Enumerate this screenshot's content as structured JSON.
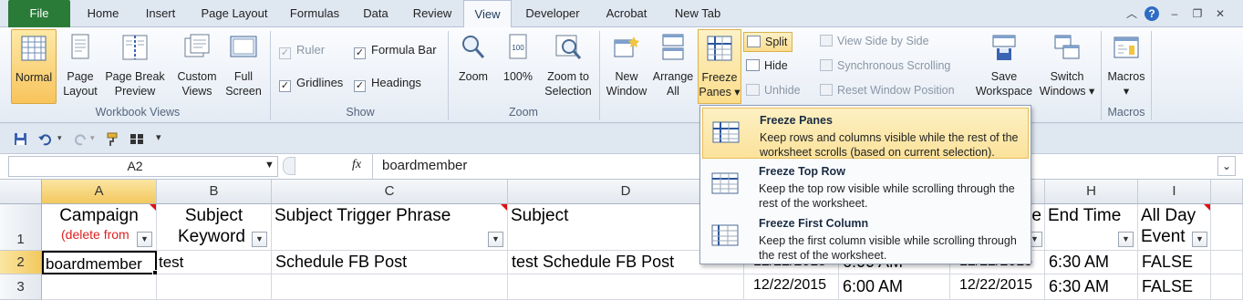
{
  "tabs": [
    "File",
    "Home",
    "Insert",
    "Page Layout",
    "Formulas",
    "Data",
    "Review",
    "View",
    "Developer",
    "Acrobat",
    "New Tab"
  ],
  "ribbon": {
    "workbook_views": {
      "label": "Workbook Views",
      "normal": "Normal",
      "page_layout": [
        "Page",
        "Layout"
      ],
      "page_break_preview": [
        "Page Break",
        "Preview"
      ],
      "custom_views": [
        "Custom",
        "Views"
      ],
      "full_screen": [
        "Full",
        "Screen"
      ]
    },
    "show": {
      "label": "Show",
      "ruler": "Ruler",
      "formula_bar": "Formula Bar",
      "gridlines": "Gridlines",
      "headings": "Headings"
    },
    "zoom": {
      "label": "Zoom",
      "zoom": "Zoom",
      "zoom_100": "100%",
      "zoom_to_selection": [
        "Zoom to",
        "Selection"
      ]
    },
    "window": {
      "new_window": [
        "New",
        "Window"
      ],
      "arrange_all": [
        "Arrange",
        "All"
      ],
      "freeze_panes": [
        "Freeze",
        "Panes ▾"
      ],
      "split": "Split",
      "hide": "Hide",
      "unhide": "Unhide",
      "view_side_by_side": "View Side by Side",
      "synchronous_scrolling": "Synchronous Scrolling",
      "reset_window_position": "Reset Window Position",
      "save_workspace": [
        "Save",
        "Workspace"
      ],
      "switch_windows": [
        "Switch",
        "Windows ▾"
      ]
    },
    "macros": {
      "label": "Macros",
      "macros": "Macros"
    }
  },
  "formula_bar": {
    "name_box": "A2",
    "fx": "fx",
    "content": "boardmember"
  },
  "columns": [
    "A",
    "B",
    "C",
    "D",
    "H",
    "I"
  ],
  "rows": [
    "1",
    "2",
    "3"
  ],
  "cells": {
    "a1_line1": "Campaign",
    "a1_line2": "(delete from",
    "b1_line1": "Subject",
    "b1_line2": "Keyword",
    "c1": "Subject Trigger Phrase",
    "d1": "Subject",
    "g1_partial": "e",
    "h1": "End Time",
    "i1_line1": "All Day",
    "i1_line2": "Event",
    "a2": "boardmember",
    "b2": "test",
    "c2": "Schedule FB Post",
    "d2": "test Schedule FB Post",
    "e2": "12/22/2015",
    "f2": "6:00 AM",
    "g2": "12/22/2015",
    "h2": "6:30 AM",
    "i2": "FALSE",
    "e3": "12/22/2015",
    "f3": "6:00 AM",
    "g3": "12/22/2015",
    "h3": "6:30 AM",
    "i3": "FALSE"
  },
  "freeze_menu": [
    {
      "title": "Freeze Panes",
      "desc": "Keep rows and columns visible while the rest of the worksheet scrolls (based on current selection)."
    },
    {
      "title": "Freeze Top Row",
      "desc": "Keep the top row visible while scrolling through the rest of the worksheet."
    },
    {
      "title": "Freeze First Column",
      "desc": "Keep the first column visible while scrolling through the rest of the worksheet."
    }
  ],
  "colors": {
    "file_tab": "#2a7a38",
    "highlight": "#fbe29b",
    "selected_cell_border": "#000000"
  }
}
